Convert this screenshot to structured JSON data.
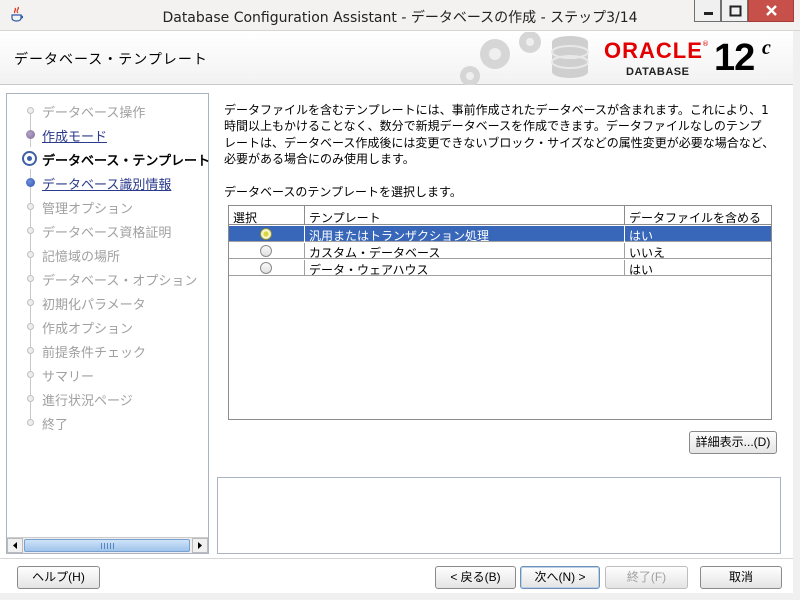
{
  "window": {
    "title": "Database Configuration Assistant - データベースの作成 - ステップ3/14"
  },
  "header": {
    "page_title": "データベース・テンプレート",
    "logo_brand": "ORACLE",
    "logo_product": "DATABASE",
    "logo_version": "12",
    "logo_version_suffix": "c",
    "brand_color": "#e20000"
  },
  "nav": {
    "items": [
      {
        "label": "データベース操作",
        "state": "todo"
      },
      {
        "label": "作成モード",
        "state": "done"
      },
      {
        "label": "データベース・テンプレート",
        "state": "current"
      },
      {
        "label": "データベース識別情報",
        "state": "next"
      },
      {
        "label": "管理オプション",
        "state": "todo"
      },
      {
        "label": "データベース資格証明",
        "state": "todo"
      },
      {
        "label": "記憶域の場所",
        "state": "todo"
      },
      {
        "label": "データベース・オプション",
        "state": "todo"
      },
      {
        "label": "初期化パラメータ",
        "state": "todo"
      },
      {
        "label": "作成オプション",
        "state": "todo"
      },
      {
        "label": "前提条件チェック",
        "state": "todo"
      },
      {
        "label": "サマリー",
        "state": "todo"
      },
      {
        "label": "進行状況ページ",
        "state": "todo"
      },
      {
        "label": "終了",
        "state": "todo"
      }
    ]
  },
  "main": {
    "description_lines": [
      "データファイルを含むテンプレートには、事前作成されたデータベースが含まれます。これにより、1",
      "時間以上もかけることなく、数分で新規データベースを作成できます。データファイルなしのテンプ",
      "レートは、データベース作成後には変更できないブロック・サイズなどの属性変更が必要な場合など、",
      "必要がある場合にのみ使用します。"
    ],
    "select_label": "データベースのテンプレートを選択します。",
    "table": {
      "columns": [
        "選択",
        "テンプレート",
        "データファイルを含める"
      ],
      "rows": [
        {
          "template": "汎用またはトランザクション処理",
          "includes_datafiles": "はい",
          "selected": true
        },
        {
          "template": "カスタム・データベース",
          "includes_datafiles": "いいえ",
          "selected": false
        },
        {
          "template": "データ・ウェアハウス",
          "includes_datafiles": "はい",
          "selected": false
        }
      ]
    },
    "detail_button": "詳細表示...(D)"
  },
  "footer": {
    "help": "ヘルプ(H)",
    "back": "< 戻る(B)",
    "next": "次へ(N) >",
    "finish": "終了(F)",
    "cancel": "取消"
  },
  "colors": {
    "selection": "#3867b9",
    "close_button": "#c7504a"
  }
}
